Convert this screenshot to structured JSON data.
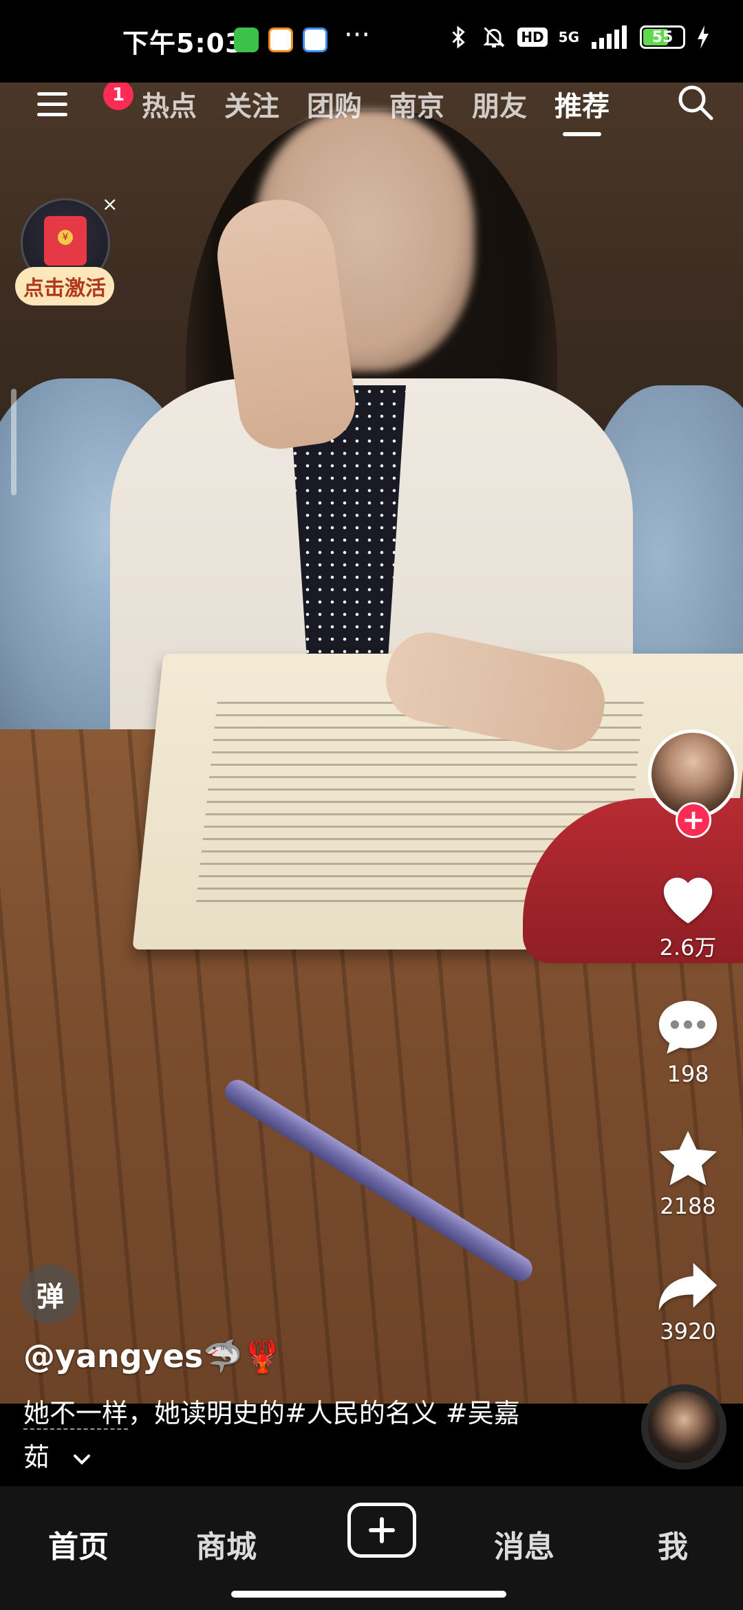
{
  "status_bar": {
    "time": "下午5:03",
    "more_glyph": "···",
    "network": "5G",
    "hd": "HD",
    "battery": "55"
  },
  "nav": {
    "badge": "1",
    "tabs": [
      "热点",
      "关注",
      "团购",
      "南京",
      "朋友",
      "推荐"
    ],
    "active_tab": "推荐"
  },
  "red_packet": {
    "label": "点击激活",
    "close": "×"
  },
  "actions": {
    "likes": "2.6万",
    "comments": "198",
    "favorites": "2188",
    "shares": "3920",
    "follow_plus": "+"
  },
  "post": {
    "danmu_label": "弹",
    "username": "@yangyes🦈🦞",
    "caption_part1": "她不一样",
    "caption_part2": "，她读明史的#人民的名义 #吴嘉",
    "caption_part3": "茹"
  },
  "tabbar": {
    "home": "首页",
    "mall": "商城",
    "messages": "消息",
    "me": "我"
  },
  "colors": {
    "accent": "#fe2c55",
    "red_packet_bg": "#fde6b9",
    "battery_fill": "#62d84e"
  },
  "icons": [
    "menu-icon",
    "search-icon",
    "heart-icon",
    "comment-icon",
    "star-icon",
    "share-icon",
    "plus-icon",
    "chevron-down-icon",
    "bluetooth-icon",
    "mute-bell-icon",
    "signal-icon",
    "battery-icon",
    "charging-icon"
  ]
}
